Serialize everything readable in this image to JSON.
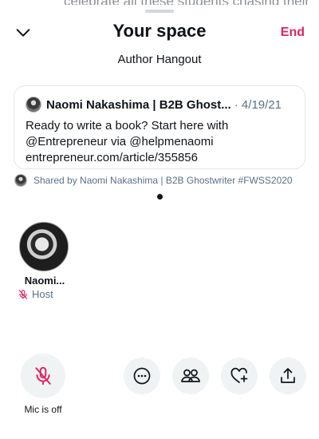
{
  "background": {
    "text": "celebrate all these students chasing their"
  },
  "header": {
    "title": "Your space",
    "end_label": "End"
  },
  "space": {
    "topic": "Author Hangout"
  },
  "tweet": {
    "author": "Naomi Nakashima | B2B Ghost...",
    "date": "· 4/19/21",
    "line1": "Ready to write a book? Start here with",
    "line2": "@Entrepreneur via @helpmenaomi",
    "line3": "entrepreneur.com/article/355856"
  },
  "shared_by": "Shared by Naomi Nakashima | B2B Ghostwriter #FWSS2020",
  "speaker": {
    "name": "Naomi...",
    "role": "Host"
  },
  "controls": {
    "mic_label": "Mic is off"
  },
  "colors": {
    "accent": "#e0245e",
    "muted": "#5b7083",
    "control_bg": "#eff3f4"
  },
  "icons": [
    "chevron-down-icon",
    "mic-off-icon",
    "more-icon",
    "people-icon",
    "heart-plus-icon",
    "share-icon"
  ]
}
